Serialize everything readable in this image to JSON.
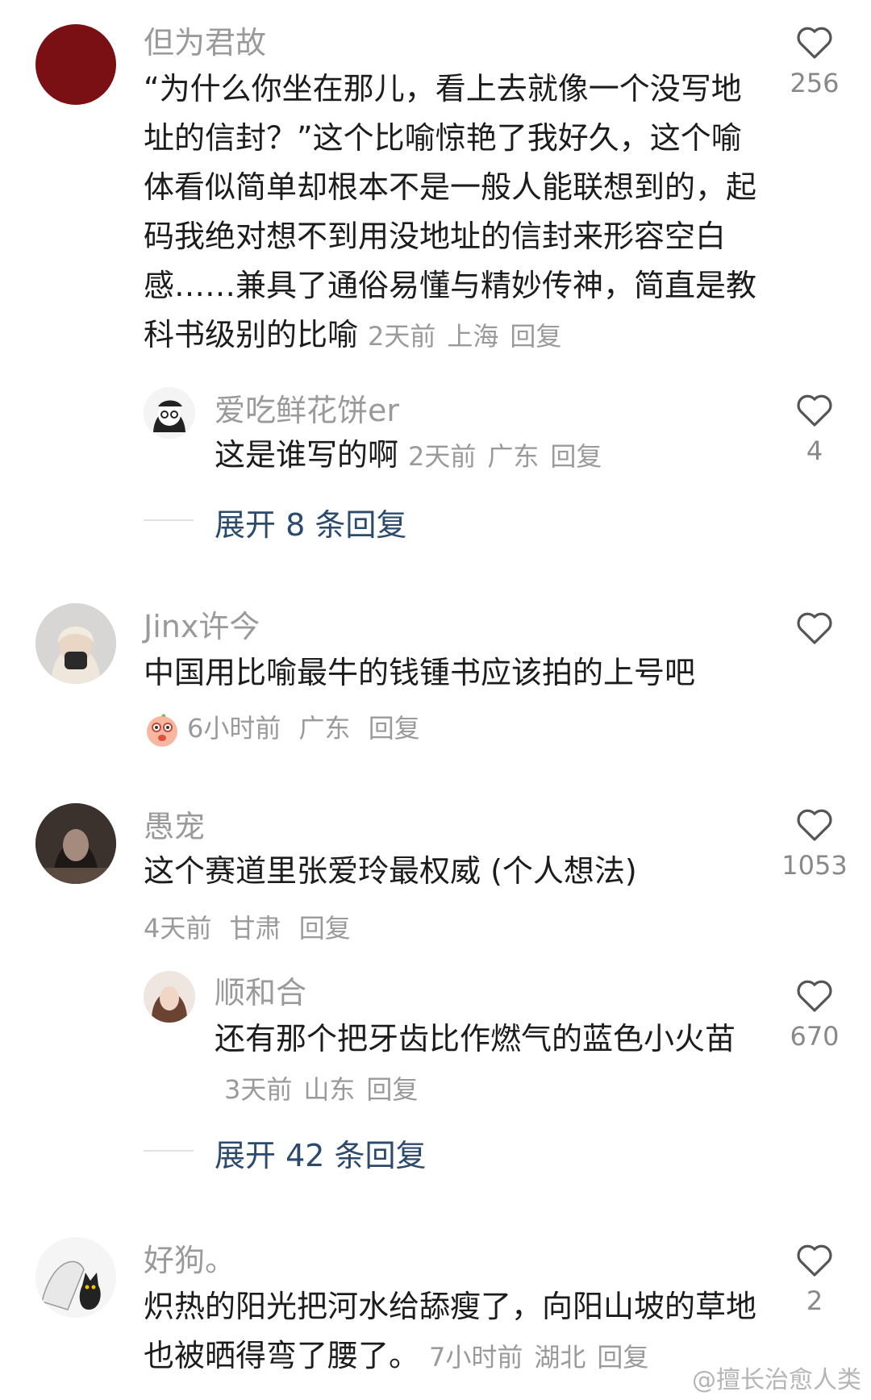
{
  "comments": [
    {
      "username": "但为君故",
      "text": "“为什么你坐在那儿，看上去就像一个没写地址的信封？”这个比喻惊艳了我好久，这个喻体看似简单却根本不是一般人能联想到的，起码我绝对想不到用没地址的信封来形容空白感……兼具了通俗易懂与精妙传神，简直是教科书级别的比喻",
      "time": "2天前",
      "location": "上海",
      "reply_label": "回复",
      "likes": "256",
      "avatar_color": "#7a0f14",
      "replies": [
        {
          "username": "爱吃鲜花饼er",
          "text": "这是谁写的啊",
          "time": "2天前",
          "location": "广东",
          "reply_label": "回复",
          "likes": "4"
        }
      ],
      "expand_label": "展开 8 条回复"
    },
    {
      "username": "Jinx许今",
      "text": "中国用比喻最牛的钱锺书应该拍的上号吧",
      "time": "6小时前",
      "location": "广东",
      "reply_label": "回复",
      "likes": "",
      "emoji": "emoji-face"
    },
    {
      "username": "愚宠",
      "text": "这个赛道里张爱玲最权威 (个人想法)",
      "time": "4天前",
      "location": "甘肃",
      "reply_label": "回复",
      "likes": "1053",
      "replies": [
        {
          "username": "顺和合",
          "text": "还有那个把牙齿比作燃气的蓝色小火苗",
          "time": "3天前",
          "location": "山东",
          "reply_label": "回复",
          "likes": "670"
        }
      ],
      "expand_label": "展开 42 条回复"
    },
    {
      "username": "好狗。",
      "text": "炽热的阳光把河水给舔瘦了，向阳山坡的草地也被晒得弯了腰了。",
      "time": "7小时前",
      "location": "湖北",
      "reply_label": "回复",
      "likes": "2"
    }
  ],
  "watermark": "@擅长治愈人类"
}
